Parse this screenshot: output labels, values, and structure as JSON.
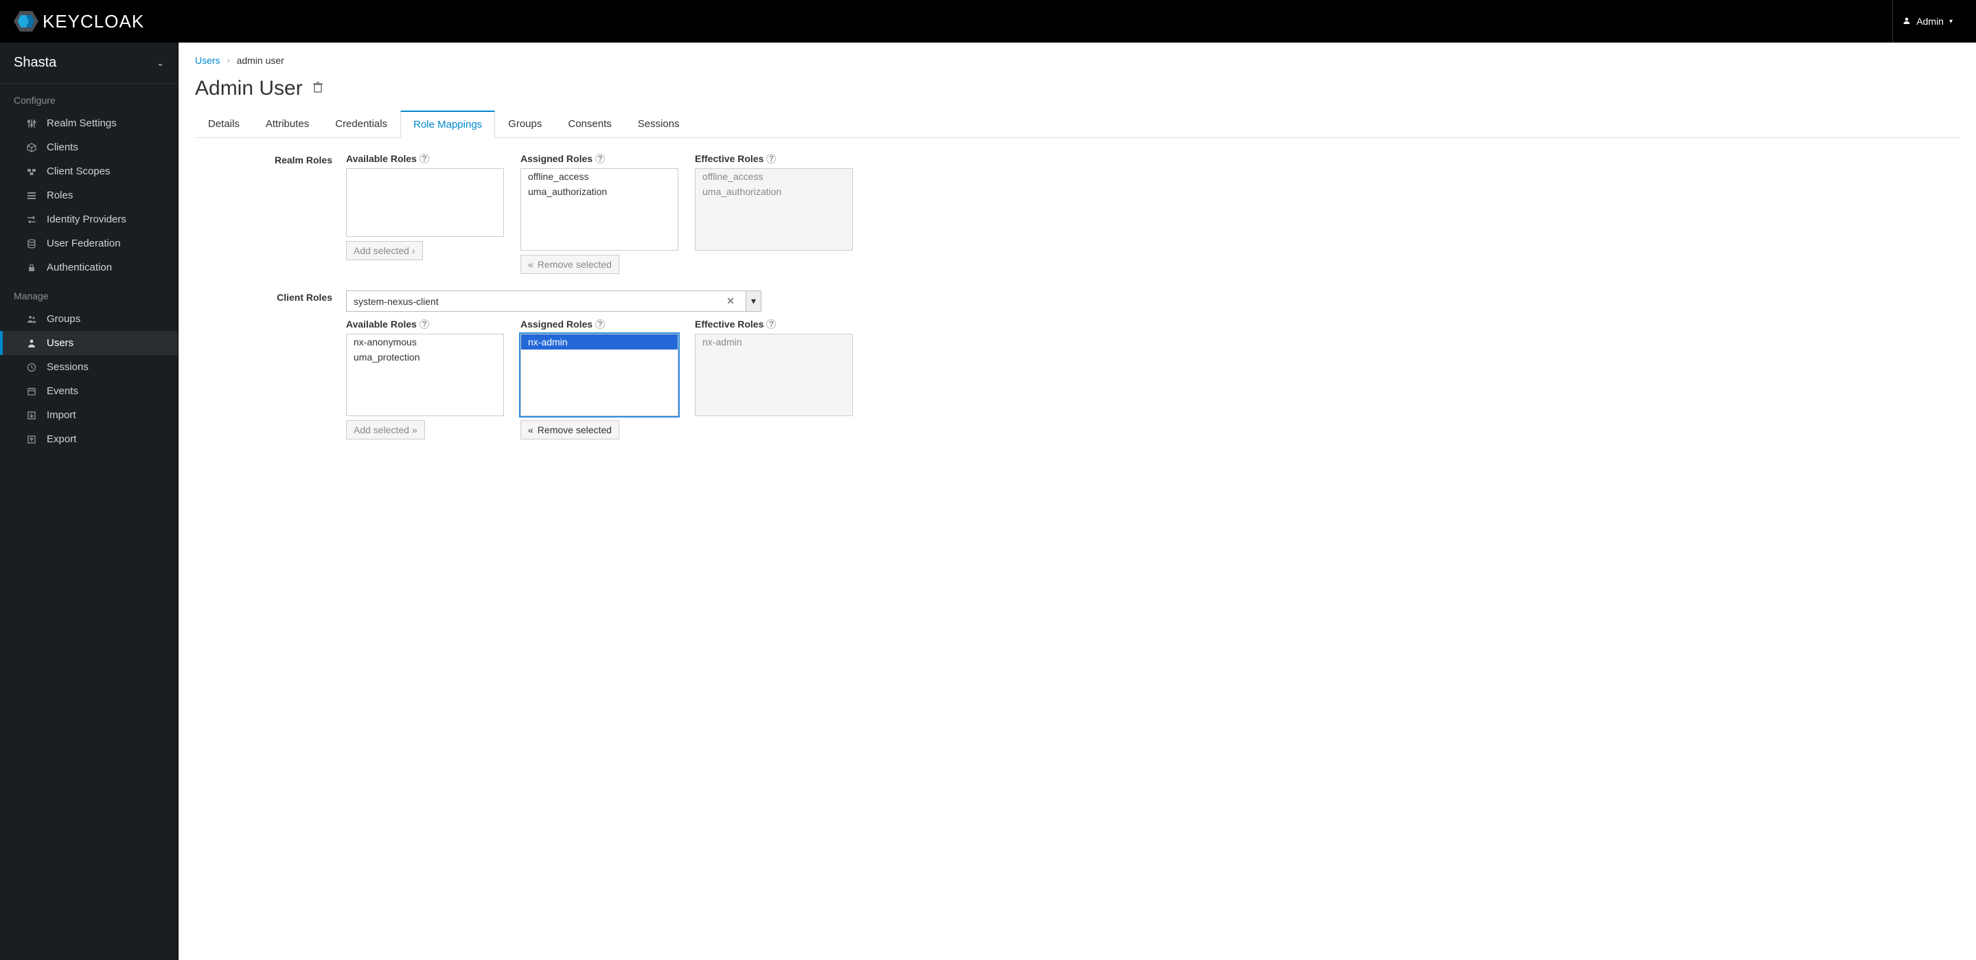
{
  "header": {
    "brand": "KEYCLOAK",
    "user": "Admin"
  },
  "sidebar": {
    "realm": "Shasta",
    "section1": "Configure",
    "section2": "Manage",
    "items1": [
      {
        "label": "Realm Settings"
      },
      {
        "label": "Clients"
      },
      {
        "label": "Client Scopes"
      },
      {
        "label": "Roles"
      },
      {
        "label": "Identity Providers"
      },
      {
        "label": "User Federation"
      },
      {
        "label": "Authentication"
      }
    ],
    "items2": [
      {
        "label": "Groups"
      },
      {
        "label": "Users"
      },
      {
        "label": "Sessions"
      },
      {
        "label": "Events"
      },
      {
        "label": "Import"
      },
      {
        "label": "Export"
      }
    ]
  },
  "breadcrumb": {
    "root": "Users",
    "leaf": "admin user"
  },
  "page": {
    "title": "Admin User"
  },
  "tabs": [
    "Details",
    "Attributes",
    "Credentials",
    "Role Mappings",
    "Groups",
    "Consents",
    "Sessions"
  ],
  "labels": {
    "realmRoles": "Realm Roles",
    "clientRoles": "Client Roles",
    "available": "Available Roles",
    "assigned": "Assigned Roles",
    "effective": "Effective Roles",
    "addSelected": "Add selected",
    "removeSelected": "Remove selected"
  },
  "realm_section": {
    "available": [],
    "assigned": [
      "offline_access",
      "uma_authorization"
    ],
    "effective": [
      "offline_access",
      "uma_authorization"
    ]
  },
  "client_section": {
    "selected_client": "system-nexus-client",
    "available": [
      "nx-anonymous",
      "uma_protection"
    ],
    "assigned": [
      "nx-admin"
    ],
    "assigned_selected": "nx-admin",
    "effective": [
      "nx-admin"
    ]
  }
}
